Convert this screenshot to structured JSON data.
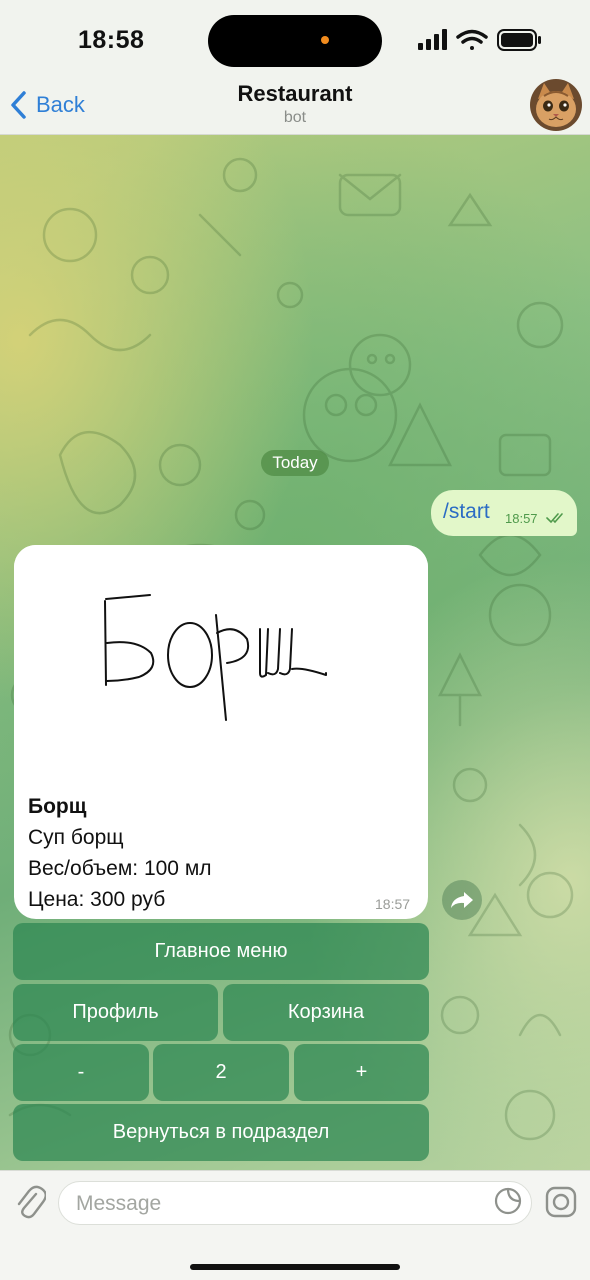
{
  "status_bar": {
    "time": "18:58"
  },
  "nav": {
    "back_label": "Back",
    "title": "Restaurant",
    "subtitle": "bot"
  },
  "chat": {
    "date_label": "Today",
    "outgoing": {
      "text": "/start",
      "time": "18:57"
    },
    "incoming": {
      "caption_title": "Борщ",
      "caption_lines": [
        "Суп борщ",
        "Вес/объем: 100 мл",
        "Цена: 300 руб"
      ],
      "time": "18:57"
    }
  },
  "keyboard": {
    "main_menu": "Главное меню",
    "profile": "Профиль",
    "cart": "Корзина",
    "minus": "-",
    "quantity": "2",
    "plus": "+",
    "back_to_section": "Вернуться в подраздел"
  },
  "input": {
    "placeholder": "Message"
  },
  "colors": {
    "accent": "#2f7fd6",
    "outgoing_bubble": "#e2f7c9",
    "keyboard_button": "#2c8652"
  }
}
